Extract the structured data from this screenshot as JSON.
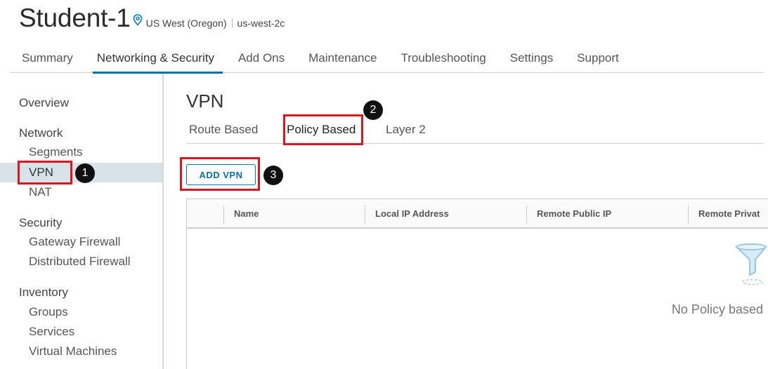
{
  "header": {
    "title": "Student-1",
    "location_icon": "map-pin-icon",
    "region": "US West (Oregon)",
    "zone": "us-west-2c"
  },
  "top_tabs": [
    {
      "label": "Summary"
    },
    {
      "label": "Networking & Security",
      "active": true
    },
    {
      "label": "Add Ons"
    },
    {
      "label": "Maintenance"
    },
    {
      "label": "Troubleshooting"
    },
    {
      "label": "Settings"
    },
    {
      "label": "Support"
    }
  ],
  "sidebar": {
    "overview": "Overview",
    "network_head": "Network",
    "segments": "Segments",
    "vpn": "VPN",
    "nat": "NAT",
    "security_head": "Security",
    "gateway_firewall": "Gateway Firewall",
    "distributed_firewall": "Distributed Firewall",
    "inventory_head": "Inventory",
    "groups": "Groups",
    "services": "Services",
    "virtual_machines": "Virtual Machines"
  },
  "main": {
    "title": "VPN",
    "sub_tabs": {
      "route_based": "Route Based",
      "policy_based": "Policy Based",
      "layer2": "Layer 2"
    },
    "add_button": "ADD VPN",
    "columns": [
      "Name",
      "Local IP Address",
      "Remote Public IP",
      "Remote Privat"
    ],
    "empty_icon": "filter-funnel-icon",
    "empty_text": "No Policy based"
  },
  "annotations": {
    "badge1": "1",
    "badge2": "2",
    "badge3": "3",
    "highlight_color": "#e0141e"
  },
  "colors": {
    "accent": "#0072a3",
    "selected_bg": "#d8e3e9"
  }
}
